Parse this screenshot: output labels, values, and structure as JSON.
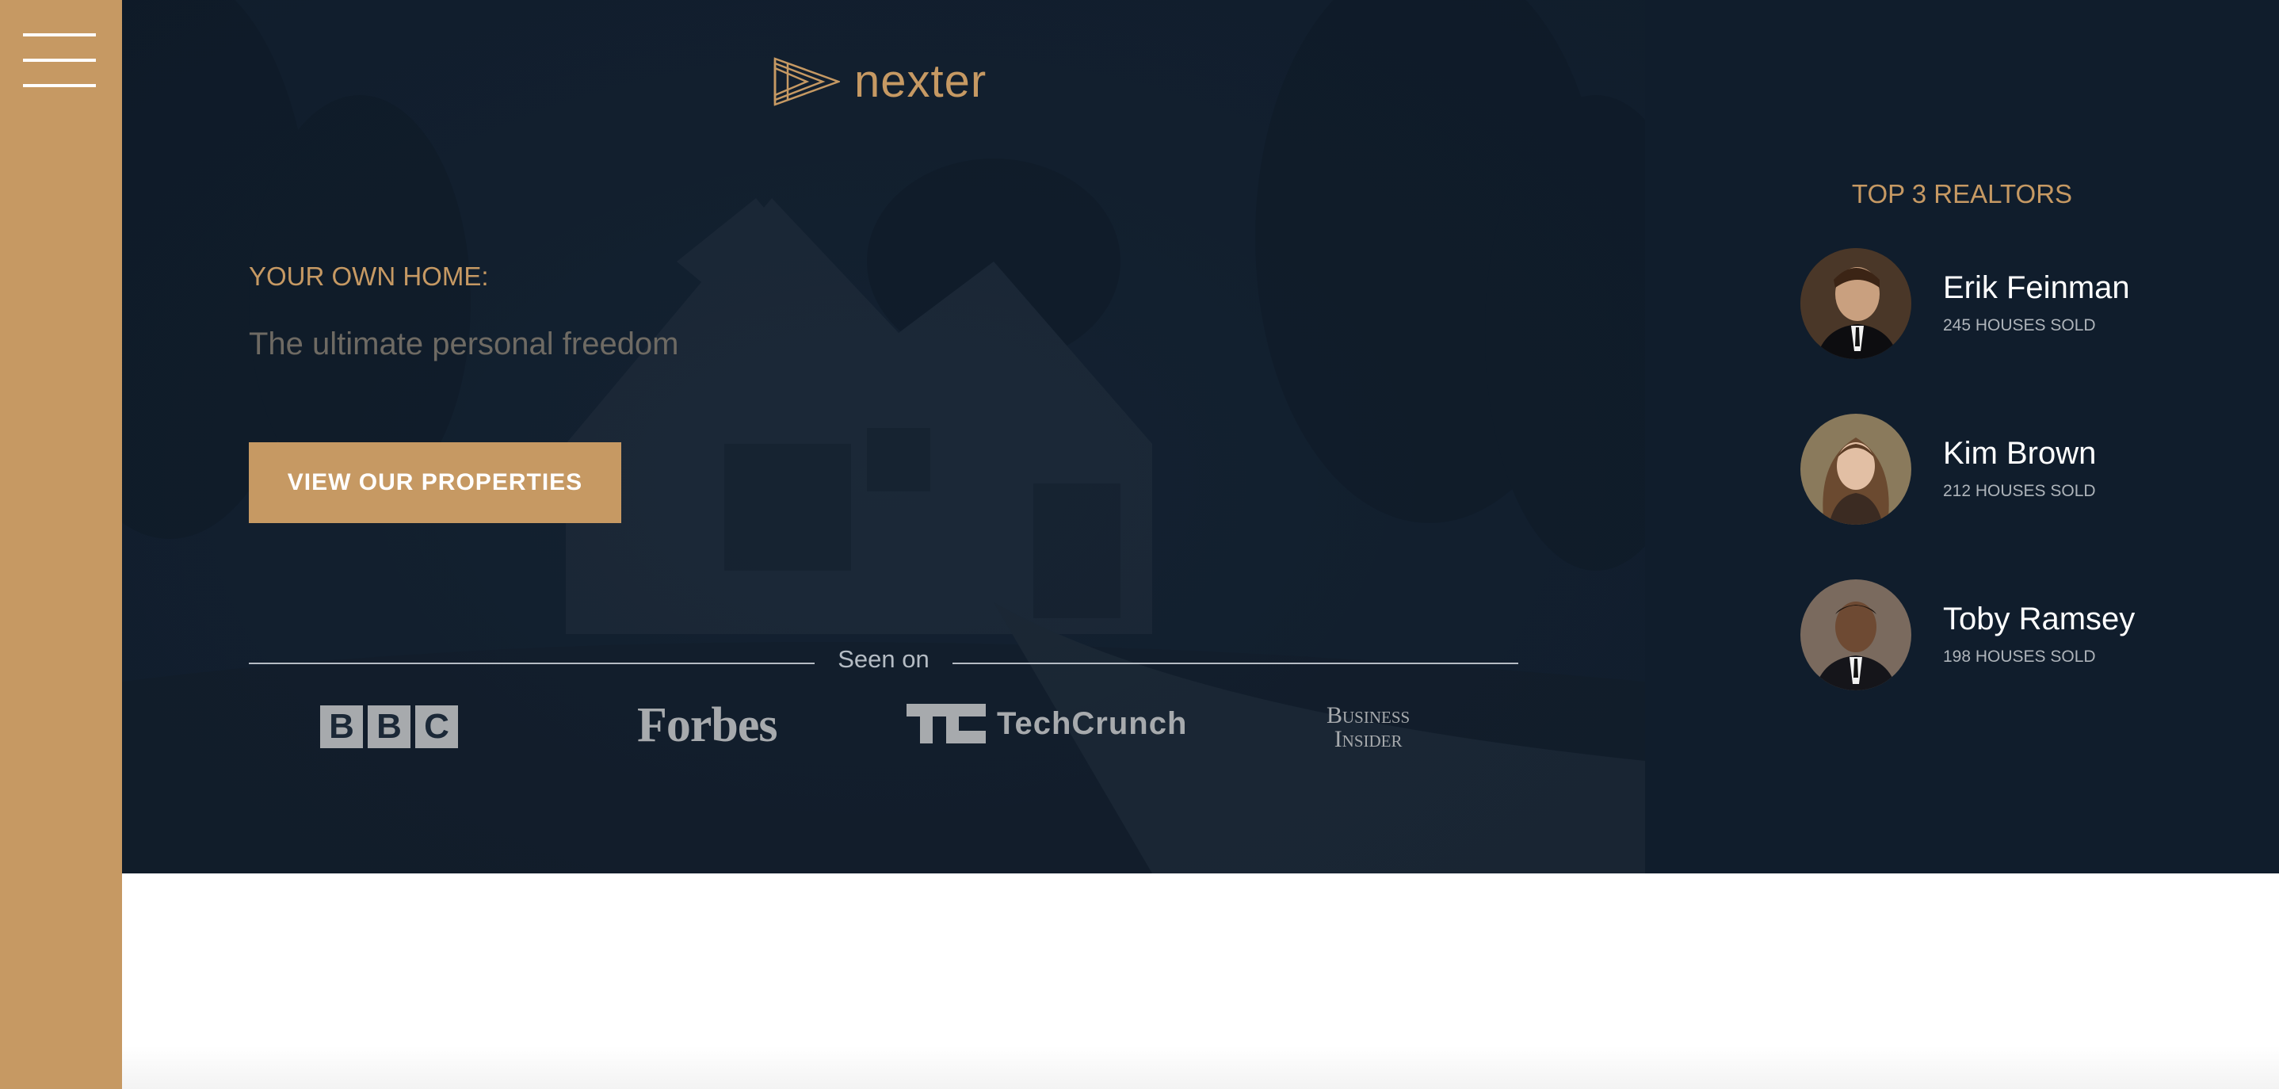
{
  "sidebar": {
    "menu_icon": "hamburger-icon"
  },
  "header": {
    "logo": {
      "icon": "triple-play-triangle-icon",
      "text": "nexter"
    },
    "subtitle": "YOUR OWN HOME:",
    "heading": "The ultimate personal freedom",
    "cta_label": "VIEW OUR PROPERTIES",
    "seen_on": {
      "label": "Seen on",
      "logos": {
        "bbc": [
          "B",
          "B",
          "C"
        ],
        "forbes": "Forbes",
        "techcrunch": "TechCrunch",
        "business_insider_line1": "Business",
        "business_insider_line2": "Insider"
      }
    }
  },
  "realtors": {
    "title": "TOP 3 REALTORS",
    "items": [
      {
        "name": "Erik Feinman",
        "sold": "245 HOUSES SOLD",
        "avatar": "man-suit-photo"
      },
      {
        "name": "Kim Brown",
        "sold": "212 HOUSES SOLD",
        "avatar": "woman-portrait-photo"
      },
      {
        "name": "Toby Ramsey",
        "sold": "198 HOUSES SOLD",
        "avatar": "man-smiling-photo"
      }
    ]
  },
  "colors": {
    "primary": "#c69963",
    "dark": "#101d2c",
    "grey_light": "#b5bcc4",
    "white": "#ffffff"
  }
}
